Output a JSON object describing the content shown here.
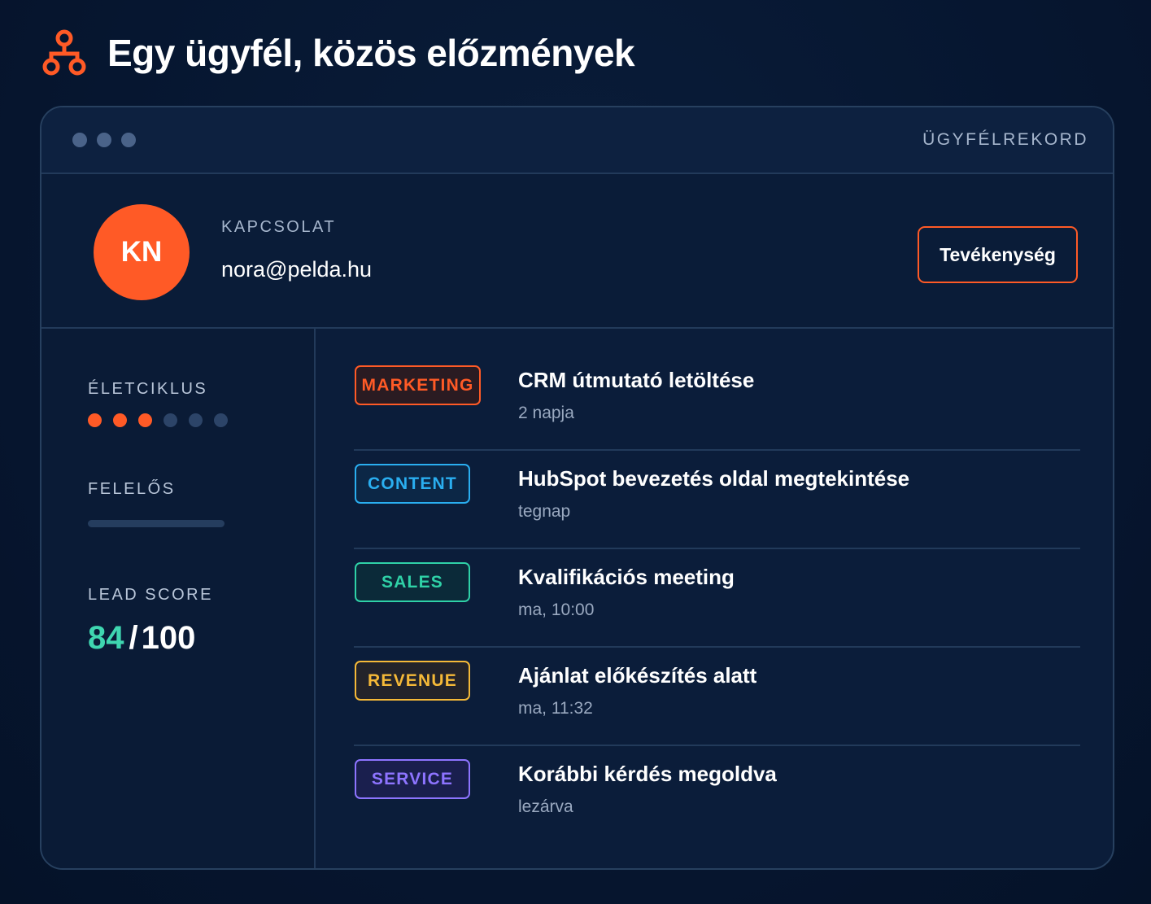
{
  "header": {
    "title": "Egy ügyfél, közös előzmények",
    "icon": "org-chart-icon",
    "accent_color": "#ff5a26"
  },
  "window": {
    "record_label": "ÜGYFÉLREKORD"
  },
  "contact": {
    "avatar_initials": "KN",
    "label": "KAPCSOLAT",
    "email": "nora@pelda.hu",
    "action_label": "Tevékenység"
  },
  "sidebar": {
    "lifecycle_label": "ÉLETCIKLUS",
    "lifecycle_steps_total": 6,
    "lifecycle_steps_done": 3,
    "owner_label": "FELELŐS",
    "lead_score_label": "LEAD SCORE",
    "lead_score_value": "84",
    "lead_score_separator": "/",
    "lead_score_max": "100"
  },
  "activities": [
    {
      "tag": "MARKETING",
      "tag_color": "#ff5a26",
      "tag_bg": "#2a1b22",
      "title": "CRM útmutató letöltése",
      "time": "2 napja"
    },
    {
      "tag": "CONTENT",
      "tag_color": "#2aaef0",
      "tag_bg": "#0c2746",
      "title": "HubSpot bevezetés oldal megtekintése",
      "time": "tegnap"
    },
    {
      "tag": "SALES",
      "tag_color": "#2fd1a7",
      "tag_bg": "#0b2a39",
      "title": "Kvalifikációs meeting",
      "time": "ma, 10:00"
    },
    {
      "tag": "REVENUE",
      "tag_color": "#f5b938",
      "tag_bg": "#23232a",
      "title": "Ajánlat előkészítés alatt",
      "time": "ma, 11:32"
    },
    {
      "tag": "SERVICE",
      "tag_color": "#8d74ff",
      "tag_bg": "#1a1f4e",
      "title": "Korábbi kérdés megoldva",
      "time": "lezárva"
    }
  ]
}
